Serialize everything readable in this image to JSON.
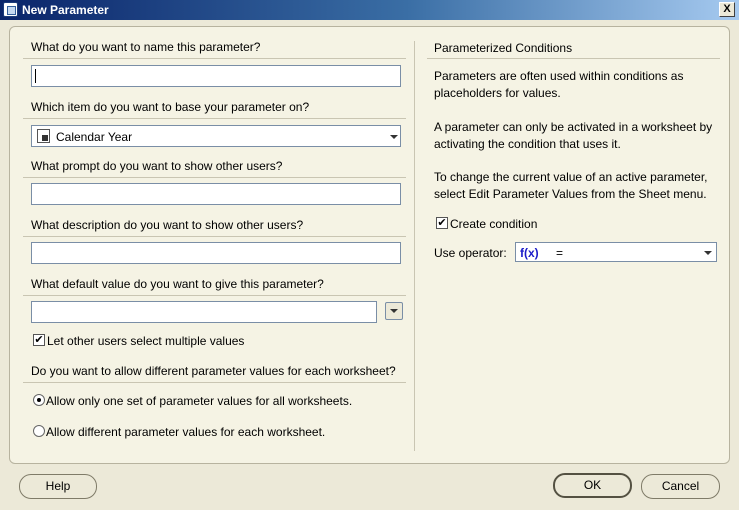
{
  "window": {
    "title": "New Parameter",
    "close_label": "X"
  },
  "left": {
    "name_question": "What do you want to name this parameter?",
    "name_value": "",
    "item_question": "Which item do you want to base your parameter on?",
    "item_value": "Calendar Year",
    "prompt_question": "What prompt do you want to show other users?",
    "prompt_value": "",
    "description_question": "What description do you want to show other users?",
    "description_value": "",
    "default_question": "What default value do you want to give this parameter?",
    "default_value": "",
    "multi_select_label": "Let other users select multiple values",
    "multi_select_checked": true,
    "worksheet_question": "Do you want to allow different parameter values for each worksheet?",
    "radio_one_label": "Allow only one set of parameter values for all worksheets.",
    "radio_diff_label": "Allow different parameter values for each worksheet.",
    "selected_radio": "one"
  },
  "right": {
    "heading": "Parameterized Conditions",
    "para1": "Parameters are often used within conditions as placeholders for values.",
    "para2": "A parameter can only be activated in a worksheet by activating the condition that uses it.",
    "para3": "To change the current value of an active parameter, select Edit Parameter Values from the Sheet menu.",
    "create_condition_label": "Create condition",
    "create_condition_checked": true,
    "operator_label": "Use operator:",
    "operator_fx": "f(x)",
    "operator_value": "="
  },
  "buttons": {
    "help": "Help",
    "ok": "OK",
    "cancel": "Cancel"
  },
  "colors": {
    "title_start": "#0a246a",
    "title_end": "#a6caf0",
    "panel_bg": "#f5f3e4",
    "fx_blue": "#1a1ac8"
  }
}
